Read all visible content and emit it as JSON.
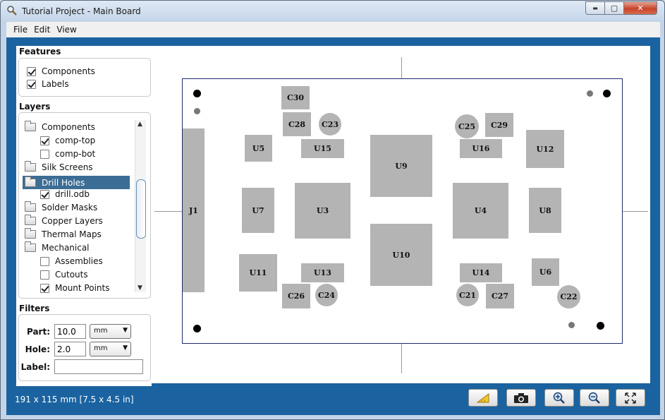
{
  "window": {
    "title": "Tutorial Project - Main Board",
    "controls": {
      "minimize": "▬",
      "maximize": "▢",
      "close": "✕"
    }
  },
  "menu": [
    "File",
    "Edit",
    "View"
  ],
  "features": {
    "title": "Features",
    "items": [
      {
        "label": "Components",
        "checked": true
      },
      {
        "label": "Labels",
        "checked": true
      }
    ]
  },
  "layers": {
    "title": "Layers",
    "items": [
      {
        "label": "Components",
        "type": "folder",
        "indent": 0,
        "selected": false
      },
      {
        "label": "comp-top",
        "type": "check",
        "checked": true,
        "indent": 1
      },
      {
        "label": "comp-bot",
        "type": "check",
        "checked": false,
        "indent": 1
      },
      {
        "label": "Silk Screens",
        "type": "folder",
        "indent": 0,
        "selected": false
      },
      {
        "label": "Drill Holes",
        "type": "folder",
        "indent": 0,
        "selected": true
      },
      {
        "label": "drill.odb",
        "type": "check",
        "checked": true,
        "indent": 1
      },
      {
        "label": "Solder Masks",
        "type": "folder",
        "indent": 0,
        "selected": false
      },
      {
        "label": "Copper Layers",
        "type": "folder",
        "indent": 0,
        "selected": false
      },
      {
        "label": "Thermal Maps",
        "type": "folder",
        "indent": 0,
        "selected": false
      },
      {
        "label": "Mechanical",
        "type": "folder",
        "indent": 0,
        "selected": false
      },
      {
        "label": "Assemblies",
        "type": "check",
        "checked": false,
        "indent": 1
      },
      {
        "label": "Cutouts",
        "type": "check",
        "checked": false,
        "indent": 1
      },
      {
        "label": "Mount Points",
        "type": "check",
        "checked": true,
        "indent": 1
      }
    ]
  },
  "filters": {
    "title": "Filters",
    "part": {
      "label": "Part:",
      "value": "10.0",
      "unit": "mm"
    },
    "hole": {
      "label": "Hole:",
      "value": "2.0",
      "unit": "mm"
    },
    "label": {
      "label": "Label:",
      "value": ""
    }
  },
  "board": {
    "components": [
      "C30",
      "C28",
      "C23",
      "U5",
      "U15",
      "U9",
      "C25",
      "C29",
      "U16",
      "U12",
      "J1",
      "U7",
      "U3",
      "U4",
      "U8",
      "U10",
      "U11",
      "U13",
      "U14",
      "U6",
      "C26",
      "C24",
      "C21",
      "C27",
      "C22"
    ],
    "colors": {
      "component": "#b4b4b4",
      "outline": "#1e2a6a",
      "crosshair": "#999999",
      "hole_large": "#000000",
      "hole_small": "#777777"
    }
  },
  "status": {
    "dimensions": "191 x 115 mm  [7.5 x 4.5 in]"
  },
  "toolbar": [
    "ruler-icon",
    "camera-icon",
    "zoom-in-icon",
    "zoom-out-icon",
    "fit-icon"
  ]
}
